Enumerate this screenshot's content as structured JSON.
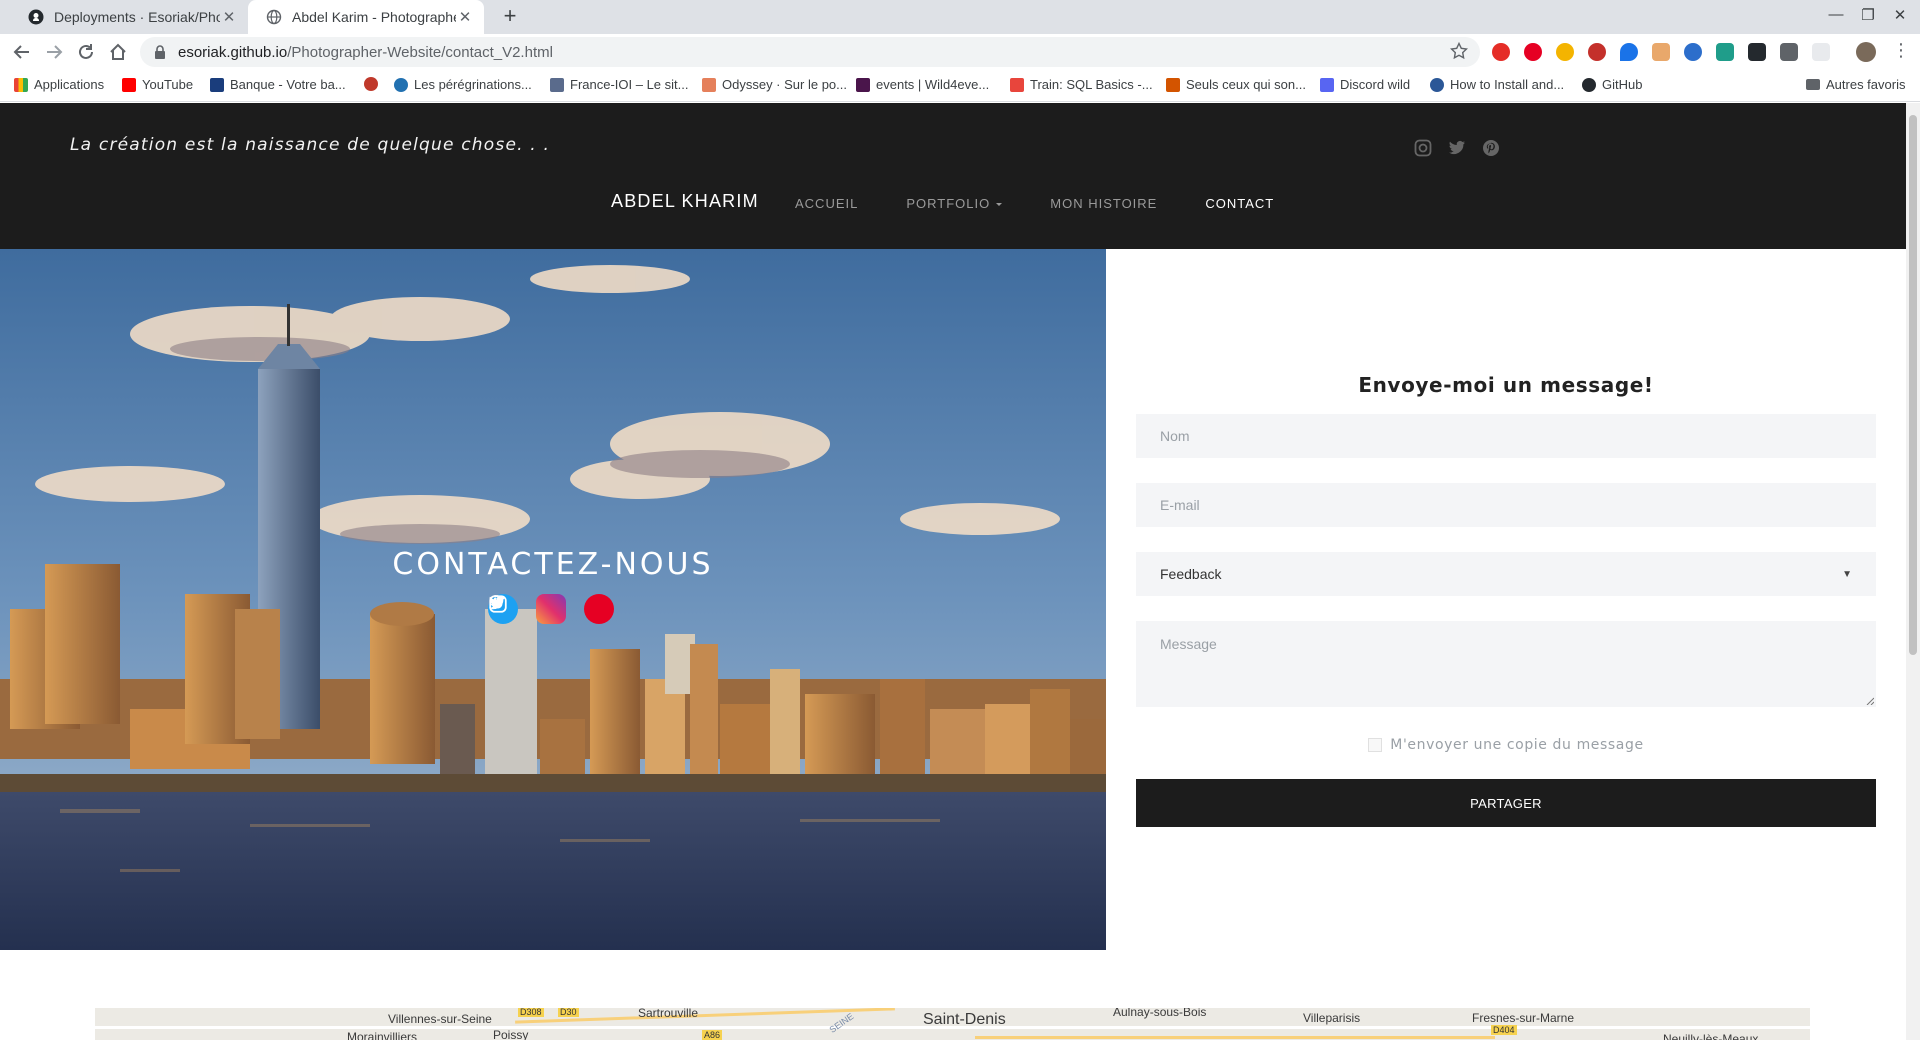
{
  "browser": {
    "tabs": [
      {
        "title": "Deployments · Esoriak/Photographer-Website",
        "active": false
      },
      {
        "title": "Abdel Karim - Photographe",
        "active": true
      }
    ],
    "url_host": "esoriak.github.io",
    "url_path": "/Photographer-Website/contact_V2.html",
    "bookmarks": [
      {
        "label": "Applications",
        "color": "#ea4335"
      },
      {
        "label": "YouTube",
        "color": "#ff0000"
      },
      {
        "label": "Banque - Votre ba...",
        "color": "#1a3d7c"
      },
      {
        "label": "",
        "color": "#c0392b"
      },
      {
        "label": "Les pérégrinations...",
        "color": "#2271b1"
      },
      {
        "label": "France-IOI – Le sit...",
        "color": "#5a6b8c"
      },
      {
        "label": "Odyssey · Sur le po...",
        "color": "#e5805b"
      },
      {
        "label": "events | Wild4eve...",
        "color": "#4a154b"
      },
      {
        "label": "Train: SQL Basics -...",
        "color": "#e8453c"
      },
      {
        "label": "Seuls ceux qui son...",
        "color": "#d35400"
      },
      {
        "label": "Discord wild",
        "color": "#5865f2"
      },
      {
        "label": "How to Install and...",
        "color": "#2b5797"
      },
      {
        "label": "GitHub",
        "color": "#24292e"
      }
    ],
    "other_bookmarks": "Autres favoris"
  },
  "header": {
    "tagline": "La création est la naissance de quelque chose. . .",
    "brand": "ABDEL KHARIM",
    "menu": [
      {
        "label": "ACCUEIL",
        "active": false
      },
      {
        "label": "PORTFOLIO",
        "active": false,
        "dropdown": true
      },
      {
        "label": "MON HISTOIRE",
        "active": false
      },
      {
        "label": "CONTACT",
        "active": true
      }
    ],
    "social_icons": [
      "instagram-icon",
      "twitter-icon",
      "pinterest-icon"
    ]
  },
  "hero": {
    "title": "CONTACTEZ-NOUS",
    "social_icons": [
      "twitter-icon",
      "instagram-icon",
      "pinterest-icon"
    ]
  },
  "form": {
    "title": "Envoye-moi un message!",
    "name_placeholder": "Nom",
    "email_placeholder": "E-mail",
    "subject_selected": "Feedback",
    "message_placeholder": "Message",
    "copy_label": "M'envoyer une copie du message",
    "submit_label": "PARTAGER"
  },
  "map": {
    "places": [
      "Villennes-sur-Seine",
      "Sartrouville",
      "Saint-Denis",
      "Aulnay-sous-Bois",
      "Villeparisis",
      "Fresnes-sur-Marne",
      "Morainvilliers",
      "Poissy",
      "Neuilly-lès-Meaux"
    ],
    "road_labels": [
      "D308",
      "D30",
      "D308",
      "A86",
      "D404",
      "SEINE"
    ]
  },
  "colors": {
    "header_bg": "#1c1c1c",
    "button_bg": "#1c1c1c",
    "field_bg": "#f4f5f7",
    "twitter": "#1da1f2",
    "pinterest": "#e60023"
  }
}
